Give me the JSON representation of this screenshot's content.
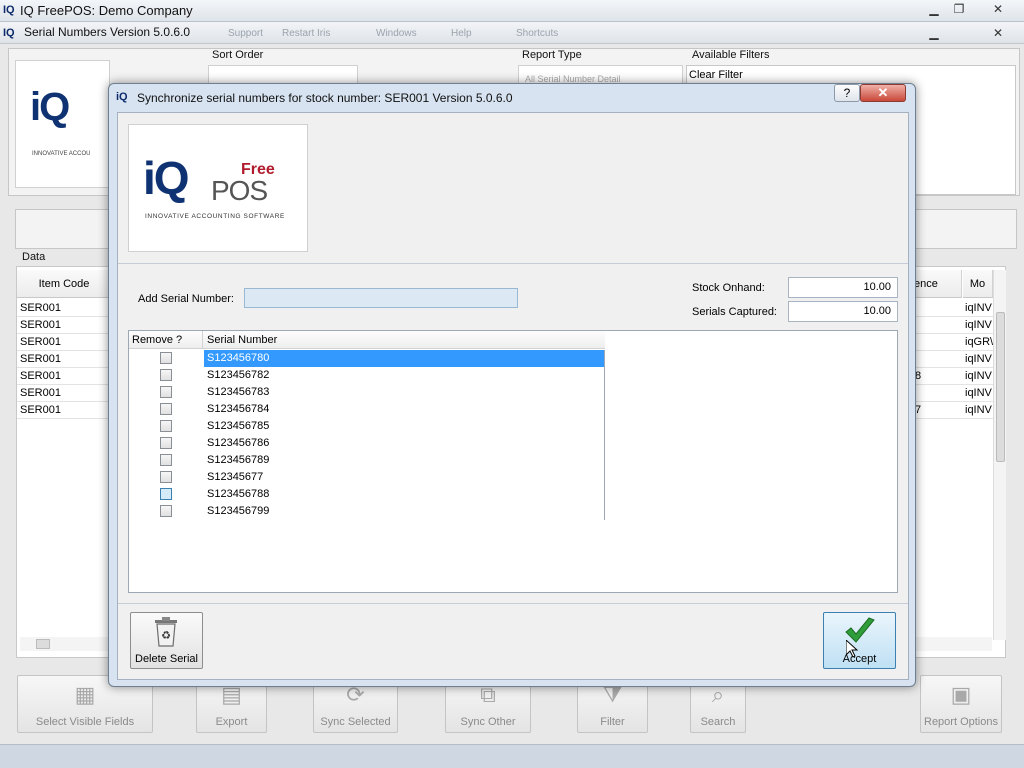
{
  "app": {
    "title": "IQ FreePOS: Demo Company",
    "subtitle": "Serial Numbers Version 5.0.6.0",
    "badge": "IQ",
    "menu": [
      "Support",
      "Restart Iris",
      "Windows",
      "Help",
      "Shortcuts"
    ]
  },
  "background": {
    "sort_order_label": "Sort Order",
    "report_type_label": "Report Type",
    "report_type_value": "All Serial Number Detail",
    "available_filters_label": "Available Filters",
    "clear_filter": "Clear Filter",
    "data_label": "Data",
    "columns": [
      "Item Code",
      "ence",
      "Mo"
    ],
    "rows": [
      {
        "code": "SER001",
        "seq": "",
        "mod": "iqINV"
      },
      {
        "code": "SER001",
        "seq": "",
        "mod": "iqINV"
      },
      {
        "code": "SER001",
        "seq": "",
        "mod": "iqGR\\"
      },
      {
        "code": "SER001",
        "seq": "",
        "mod": "iqINV"
      },
      {
        "code": "SER001",
        "seq": "8",
        "mod": "iqINV"
      },
      {
        "code": "SER001",
        "seq": "",
        "mod": "iqINV"
      },
      {
        "code": "SER001",
        "seq": "7",
        "mod": "iqINV"
      }
    ],
    "logo": {
      "text": "iQ",
      "tagline": "INNOVATIVE ACCOU"
    }
  },
  "toolbar": [
    {
      "label": "Select Visible Fields",
      "icon": "grid-icon"
    },
    {
      "label": "Export",
      "icon": "export-icon"
    },
    {
      "label": "Sync Selected",
      "icon": "sync-icon"
    },
    {
      "label": "Sync Other",
      "icon": "sync-other-icon"
    },
    {
      "label": "Filter",
      "icon": "filter-icon"
    },
    {
      "label": "Search",
      "icon": "search-icon"
    },
    {
      "label": "Report Options",
      "icon": "report-options-icon"
    }
  ],
  "dialog": {
    "badge": "iQ",
    "title": "Synchronize serial numbers for stock number: SER001 Version 5.0.6.0",
    "help": "?",
    "close": "✕",
    "logo": {
      "free": "Free",
      "iq": "iQ",
      "pos": "POS",
      "tagline": "INNOVATIVE ACCOUNTING SOFTWARE"
    },
    "add_serial_label": "Add Serial Number:",
    "add_serial_value": "",
    "stock_onhand_label": "Stock Onhand:",
    "stock_onhand_value": "10.00",
    "serials_captured_label": "Serials Captured:",
    "serials_captured_value": "10.00",
    "columns": {
      "remove": "Remove ?",
      "serial": "Serial Number"
    },
    "serials": [
      {
        "serial": "S123456780",
        "remove": false,
        "selected": true
      },
      {
        "serial": "S123456782",
        "remove": false
      },
      {
        "serial": "S123456783",
        "remove": false
      },
      {
        "serial": "S123456784",
        "remove": false
      },
      {
        "serial": "S123456785",
        "remove": false
      },
      {
        "serial": "S123456786",
        "remove": false
      },
      {
        "serial": "S123456789",
        "remove": false
      },
      {
        "serial": "S12345677",
        "remove": false
      },
      {
        "serial": "S123456788",
        "remove": false,
        "hover": true
      },
      {
        "serial": "S123456799",
        "remove": false
      }
    ],
    "delete_serial_label": "Delete Serial",
    "accept_label": "Accept",
    "accent_color": "#2f9d3a"
  }
}
